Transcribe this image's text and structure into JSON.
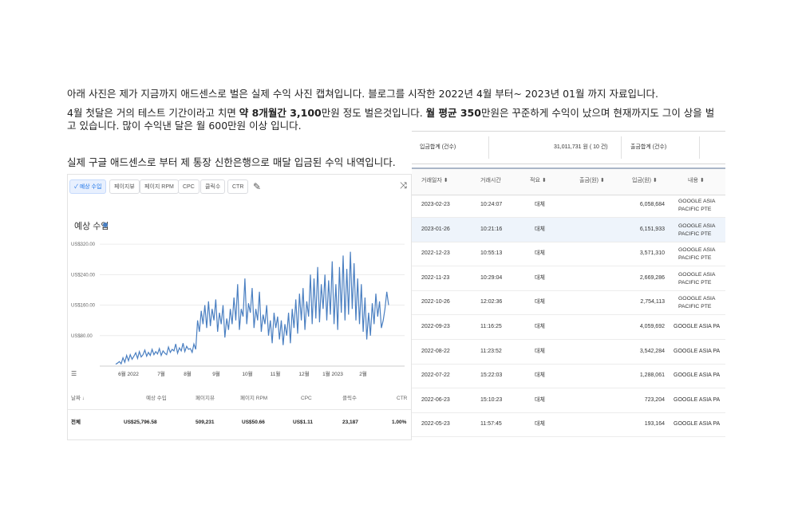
{
  "paragraph": {
    "line1": "아래 사진은 제가 지금까지 애드센스로 벌은 실제 수익 사진 캡쳐입니다. 블로그를 시작한 2022년 4월 부터~ 2023년 01월 까지 자료입니다.",
    "line2_a": "4월 첫달은 거의 테스트 기간이라고 치면 ",
    "line2_b": "약 8개월간 3,100",
    "line2_c": "만원 정도 벌은것입니다. ",
    "line2_d": "월 평균 350",
    "line2_e": "만원은 꾸준하게 수익이 났으며 현재까지도 그이 상을 벌고 있습니다. 많이 수익낸 달은 월 600만원 이상 입니다.",
    "line3": "실제 구글 애드센스로 부터 제 통장 신한은행으로 매달 입금된 수익 내역입니다."
  },
  "adsense": {
    "tabs": [
      "✓ 예상 수입",
      "페이지뷰",
      "페이지 RPM",
      "CPC",
      "클릭수",
      "CTR"
    ],
    "chart_title": "예상 수입",
    "summary_headers": [
      "날짜 ↓",
      "예상 수입",
      "페이지뷰",
      "페이지 RPM",
      "CPC",
      "클릭수",
      "CTR"
    ],
    "summary_values": [
      "전체",
      "US$25,796.58",
      "509,231",
      "US$50.66",
      "US$1.11",
      "23,187",
      "1.00%"
    ],
    "colors": {
      "line": "#4a7fc1",
      "accent": "#1a73e8"
    }
  },
  "chart_data": {
    "type": "line",
    "y_ticks": [
      "US$320.00",
      "US$240.00",
      "US$160.00",
      "US$80.00"
    ],
    "y_tick_values": [
      320,
      240,
      160,
      80
    ],
    "ylim": [
      0,
      360
    ],
    "x_ticks": [
      "6월 2022",
      "7월",
      "8월",
      "9월",
      "10월",
      "11월",
      "12월",
      "1월 2023",
      "2월"
    ],
    "series": [
      {
        "values": [
          5,
          8,
          12,
          6,
          22,
          10,
          28,
          14,
          30,
          18,
          26,
          35,
          20,
          38,
          24,
          30,
          42,
          26,
          36,
          28,
          44,
          30,
          38,
          32,
          46,
          28,
          40,
          34,
          30,
          50,
          36,
          44,
          40,
          58,
          34,
          48,
          40,
          60,
          38,
          52,
          44,
          46,
          36,
          58,
          44,
          120,
          90,
          145,
          110,
          160,
          100,
          170,
          105,
          150,
          120,
          175,
          90,
          140,
          110,
          160,
          75,
          125,
          95,
          150,
          110,
          180,
          120,
          215,
          95,
          150,
          130,
          230,
          110,
          165,
          140,
          205,
          100,
          150,
          120,
          195,
          90,
          135,
          110,
          160,
          80,
          120,
          60,
          140,
          100,
          130,
          70,
          120,
          55,
          110,
          80,
          140,
          60,
          150,
          100,
          175,
          85,
          190,
          120,
          205,
          95,
          170,
          130,
          240,
          110,
          230,
          125,
          260,
          115,
          215,
          150,
          240,
          120,
          225,
          135,
          275,
          110,
          215,
          95,
          260,
          140,
          290,
          120,
          255,
          135,
          300,
          150,
          270,
          120,
          230,
          110,
          215,
          90,
          180,
          70,
          140,
          80,
          165,
          110,
          190,
          130,
          170,
          100,
          120,
          150,
          195,
          160
        ]
      }
    ]
  },
  "bank": {
    "top_labels": [
      "입금합계 (건수)",
      "31,011,731 원 ( 10 건)",
      "출금합계 (건수)"
    ],
    "headers": [
      "거래일자 ⬍",
      "거래시간",
      "적요 ⬍",
      "출금(원) ⬍",
      "입금(원) ⬍",
      "내용 ⬍"
    ],
    "rows": [
      {
        "date": "2023-02-23",
        "time": "10:24:07",
        "memo": "대체",
        "deposit": "6,058,684",
        "content1": "GOOGLE ASIA",
        "content2": "PACIFIC PTE"
      },
      {
        "date": "2023-01-26",
        "time": "10:21:16",
        "memo": "대체",
        "deposit": "6,151,933",
        "content1": "GOOGLE ASIA",
        "content2": "PACIFIC PTE"
      },
      {
        "date": "2022-12-23",
        "time": "10:55:13",
        "memo": "대체",
        "deposit": "3,571,310",
        "content1": "GOOGLE ASIA",
        "content2": "PACIFIC PTE"
      },
      {
        "date": "2022-11-23",
        "time": "10:29:04",
        "memo": "대체",
        "deposit": "2,669,286",
        "content1": "GOOGLE ASIA",
        "content2": "PACIFIC PTE"
      },
      {
        "date": "2022-10-26",
        "time": "12:02:36",
        "memo": "대체",
        "deposit": "2,754,113",
        "content1": "GOOGLE ASIA",
        "content2": "PACIFIC PTE"
      },
      {
        "date": "2022-09-23",
        "time": "11:16:25",
        "memo": "대체",
        "deposit": "4,059,692",
        "content1": "GOOGLE ASIA PA",
        "content2": ""
      },
      {
        "date": "2022-08-22",
        "time": "11:23:52",
        "memo": "대체",
        "deposit": "3,542,284",
        "content1": "GOOGLE ASIA PA",
        "content2": ""
      },
      {
        "date": "2022-07-22",
        "time": "15:22:03",
        "memo": "대체",
        "deposit": "1,288,061",
        "content1": "GOOGLE ASIA PA",
        "content2": ""
      },
      {
        "date": "2022-06-23",
        "time": "15:10:23",
        "memo": "대체",
        "deposit": "723,204",
        "content1": "GOOGLE ASIA PA",
        "content2": ""
      },
      {
        "date": "2022-05-23",
        "time": "11:57:45",
        "memo": "대체",
        "deposit": "193,164",
        "content1": "GOOGLE ASIA PA",
        "content2": ""
      }
    ]
  }
}
